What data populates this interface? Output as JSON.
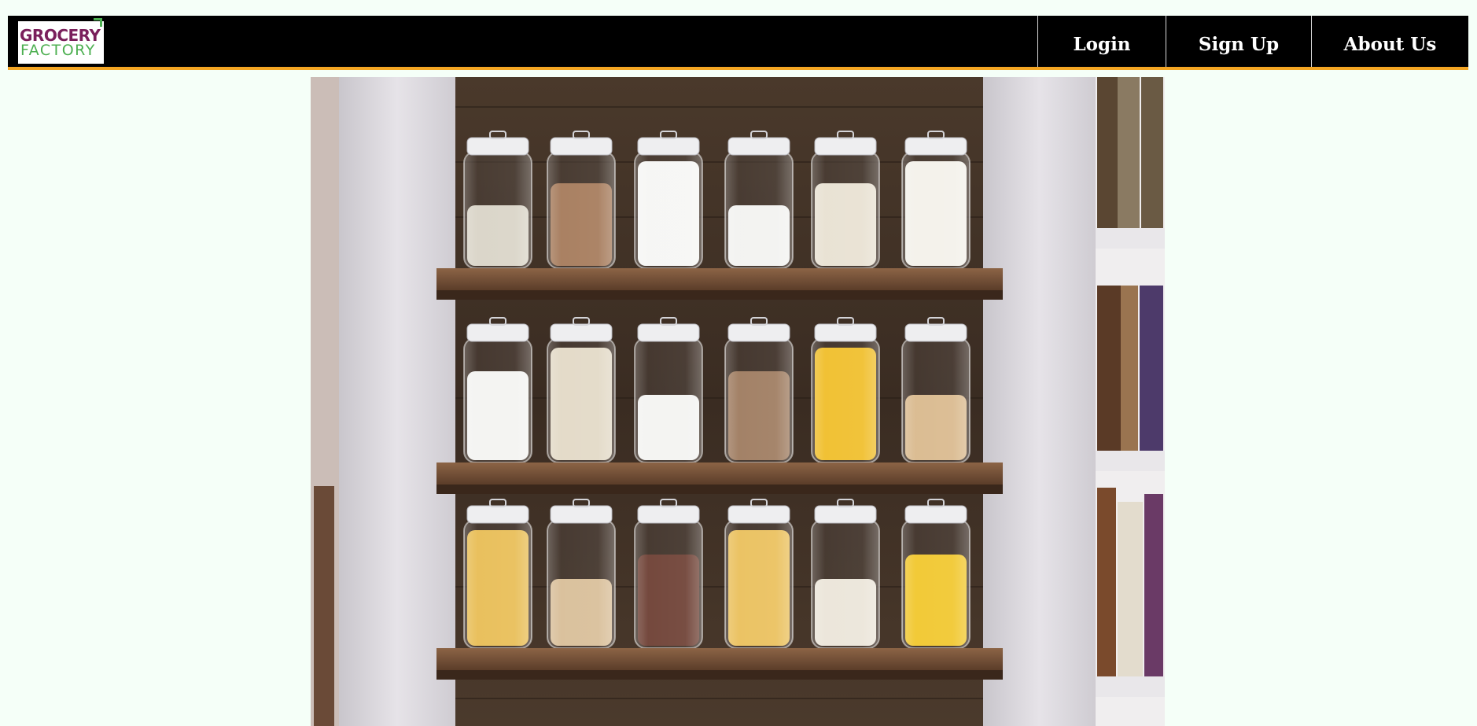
{
  "brand": {
    "line1": "GROCERY",
    "line2": "FACTORY",
    "colors": {
      "primary": "#7a1f5b",
      "secondary": "#4caf50"
    }
  },
  "nav": {
    "items": [
      {
        "label": "Login"
      },
      {
        "label": "Sign Up"
      },
      {
        "label": "About Us"
      }
    ],
    "colors": {
      "bar": "#000000",
      "underline": "#f5a623",
      "text": "#ffffff"
    }
  },
  "page": {
    "background": "#f5fff8"
  },
  "hero": {
    "subject": "pantry-shelves-with-glass-jars",
    "shelves": [
      {
        "jars": [
          "#d9d4c7",
          "#a57a5a",
          "#f6f6f4",
          "#f2f2f0",
          "#e8e1d2",
          "#f3f1ea"
        ]
      },
      {
        "jars": [
          "#f3f3f1",
          "#e2d9c6",
          "#f3f3f1",
          "#9e7b5f",
          "#f0be2a",
          "#d9b98d"
        ]
      },
      {
        "jars": [
          "#e8bd55",
          "#d8be98",
          "#6d3f33",
          "#eac05c",
          "#ebe5d9",
          "#f1c72d"
        ]
      }
    ]
  }
}
